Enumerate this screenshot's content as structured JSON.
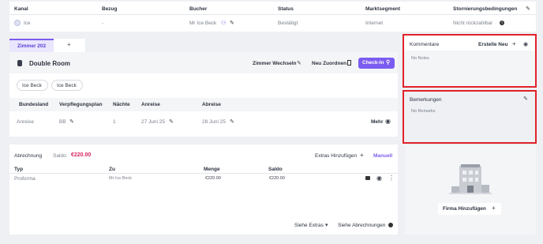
{
  "top_table": {
    "headers": [
      "Kanal",
      "Bezug",
      "Bucher",
      "Status",
      "Marktsegment",
      "Stornierungsbedingungen"
    ],
    "channel": "Ice",
    "bezug": "-",
    "bucher": "Mr Ice Beck",
    "status": "Bestätigt",
    "marktsegment": "Internet",
    "storno": "Nicht rückzahlbar"
  },
  "room_tabs": {
    "active": "Zimmer 202",
    "add": "+"
  },
  "room": {
    "type": "Double Room",
    "change_room": "Zimmer Wechseln",
    "reassign": "Neu Zuordnen",
    "checkin": "Check-In"
  },
  "guests": [
    "Ice Beck",
    "Ice Beck"
  ],
  "stay_table": {
    "headers": [
      "Bundesland",
      "Verpflegungsplan",
      "Nächte",
      "Anreise",
      "Abreise"
    ],
    "row": {
      "bundesland": "Anreise",
      "plan": "BB",
      "naechte": "1",
      "anreise": "27 Juni 25",
      "abreise": "28 Juni 25"
    },
    "more": "Mehr"
  },
  "billing": {
    "title": "Abrechnung",
    "saldo_label": "Saldo:",
    "saldo_value": "€220.00",
    "add_extras": "Extras Hinzufügen",
    "manual": "Manuell",
    "headers": [
      "Typ",
      "Zu",
      "Menge",
      "Saldo"
    ],
    "row": {
      "typ": "Proforma",
      "zu": "Mr Ice Beck",
      "menge": "€220.00",
      "saldo": "€220.00"
    },
    "see_extras": "Siehe Extras",
    "see_invoices": "Siehe Abrechnungen"
  },
  "comments": {
    "title": "Kommentare",
    "create_new": "Erstelle Neu",
    "empty": "No Notes"
  },
  "remarks": {
    "title": "Bemerkungen",
    "empty": "No Remarks"
  },
  "company": {
    "add": "Firma Hinzufügen"
  },
  "colors": {
    "accent": "#7b5cf0",
    "saldo": "#d6265f",
    "highlight": "#e0222b"
  }
}
